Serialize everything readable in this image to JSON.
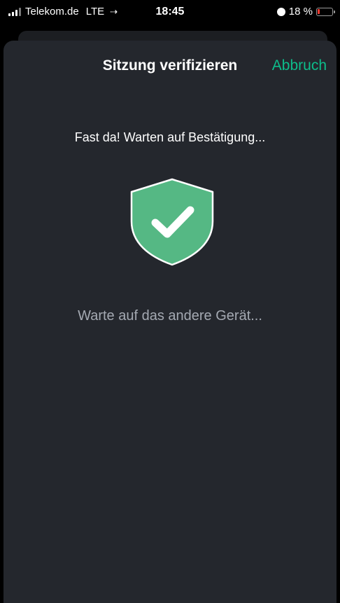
{
  "status_bar": {
    "carrier": "Telekom.de",
    "network": "LTE",
    "time": "18:45",
    "battery": "18 %",
    "battery_level": 0.18,
    "battery_color": "#ff3b30"
  },
  "header": {
    "title": "Sitzung verifizieren",
    "cancel_label": "Abbruch"
  },
  "main": {
    "message": "Fast da! Warten auf Bestätigung...",
    "shield_icon": "shield-check-icon",
    "status": "Warte auf das andere Gerät..."
  },
  "colors": {
    "accent": "#0dbd8b",
    "shield": "#55b884",
    "sheet_background": "#24272d",
    "secondary_text": "#a4a9b2"
  }
}
